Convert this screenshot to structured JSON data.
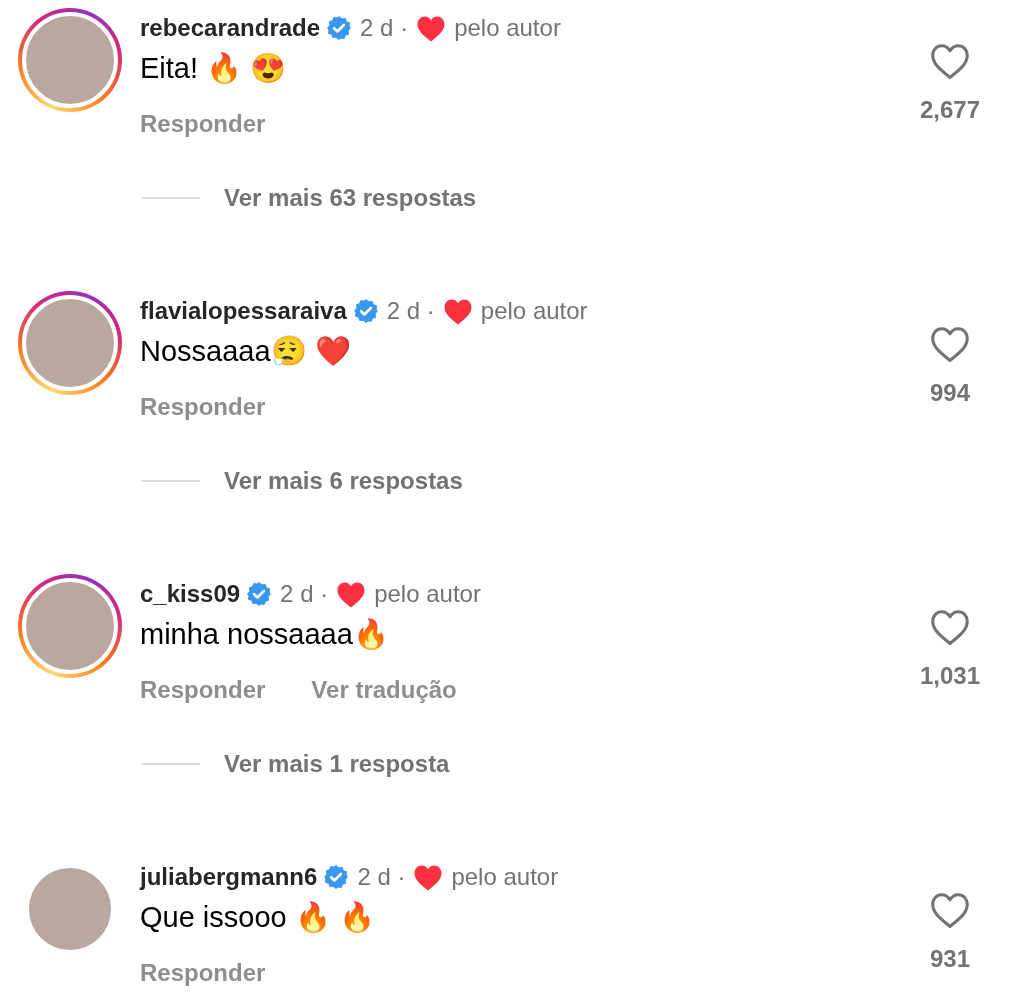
{
  "comments": [
    {
      "username": "rebecarandrade",
      "verified": true,
      "time": "2 d ·",
      "liked_by_author": true,
      "author_label": "pelo autor",
      "text": "Eita! 🔥 😍",
      "actions": [
        "Responder"
      ],
      "liked": false,
      "likes": "2,677",
      "story_ring": true,
      "more_replies": "Ver mais 63 respostas"
    },
    {
      "username": "flavialopessaraiva",
      "verified": true,
      "time": "2 d ·",
      "liked_by_author": true,
      "author_label": "pelo autor",
      "text": "Nossaaaa😮‍💨 ❤️",
      "actions": [
        "Responder"
      ],
      "liked": false,
      "likes": "994",
      "story_ring": true,
      "more_replies": "Ver mais 6 respostas"
    },
    {
      "username": "c_kiss09",
      "verified": true,
      "time": "2 d ·",
      "liked_by_author": true,
      "author_label": "pelo autor",
      "text": "minha nossaaaa🔥",
      "actions": [
        "Responder",
        "Ver tradução"
      ],
      "liked": false,
      "likes": "1,031",
      "story_ring": true,
      "more_replies": "Ver mais 1 resposta"
    },
    {
      "username": "juliabergmann6",
      "verified": true,
      "time": "2 d ·",
      "liked_by_author": true,
      "author_label": "pelo autor",
      "text": "Que issooo 🔥 🔥",
      "actions": [
        "Responder"
      ],
      "liked": false,
      "likes": "931",
      "story_ring": false
    }
  ]
}
